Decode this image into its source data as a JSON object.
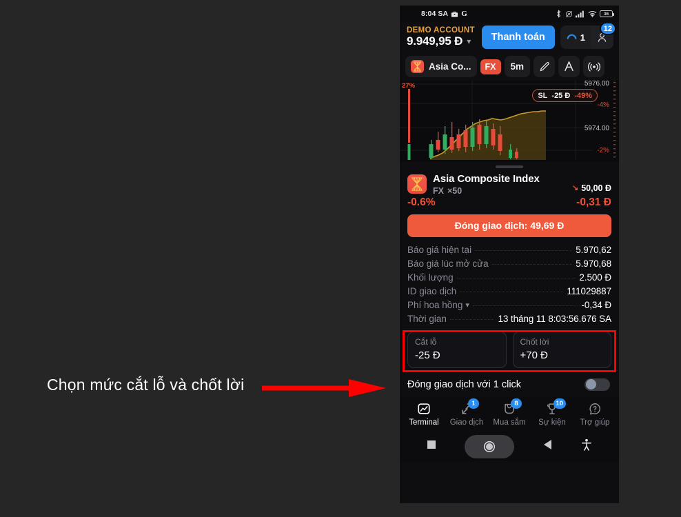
{
  "annotation": {
    "text": "Chọn mức cắt lỗ và chốt lời",
    "arrow_color": "#ff0000",
    "highlight_color": "#ff0000"
  },
  "statusbar": {
    "time": "8:04 SA",
    "icons_left": [
      "briefcase-icon",
      "google-icon"
    ],
    "google_glyph": "G",
    "icons_right": [
      "bluetooth-icon",
      "mute-icon",
      "signal-icon",
      "wifi-icon"
    ],
    "battery_level": "36"
  },
  "header": {
    "account_type": "DEMO ACCOUNT",
    "balance": "9.949,95 Đ",
    "pay_button": "Thanh toán",
    "message_count": "1",
    "profile_badge": "12"
  },
  "chart_toolbar": {
    "symbol": "Asia Co...",
    "market_tag": "FX",
    "timeframe": "5m",
    "icons": [
      "pencil-icon",
      "indicators-icon",
      "broadcast-icon"
    ]
  },
  "chart": {
    "top_left_pct": "27%",
    "price_top": "5976.00",
    "price_mid": "5974.00",
    "pct_labels": [
      "-4%",
      "-2%"
    ],
    "sl_tag": {
      "label": "SL",
      "value": "-25 Đ",
      "pct": "-49%"
    }
  },
  "position": {
    "title": "Asia Composite Index",
    "market": "FX",
    "leverage": "×50",
    "volume": "50,00 Đ",
    "change_pct": "-0.6%",
    "change_value": "-0,31 Đ",
    "close_button": "Đóng giao dịch: 49,69 Đ",
    "accent_color": "#f05a3c",
    "negative_color": "#ef5137"
  },
  "details": {
    "rows": [
      {
        "label": "Báo giá hiện tại",
        "value": "5.970,62"
      },
      {
        "label": "Báo giá lúc mở cửa",
        "value": "5.970,68"
      },
      {
        "label": "Khối lượng",
        "value": "2.500 Đ"
      },
      {
        "label": "ID giao dịch",
        "value": "111029887"
      },
      {
        "label": "Phí hoa hồng",
        "value": "-0,34 Đ"
      },
      {
        "label": "Thời gian",
        "value": "13 tháng 11 8:03:56.676 SA"
      }
    ]
  },
  "risk": {
    "stop_loss_label": "Cắt lỗ",
    "stop_loss_value": "-25 Đ",
    "take_profit_label": "Chốt lời",
    "take_profit_value": "+70 Đ"
  },
  "one_click": {
    "label": "Đóng giao dịch với 1 click",
    "enabled": false
  },
  "tabs": [
    {
      "label": "Terminal",
      "icon": "terminal-icon",
      "badge": "",
      "active": true
    },
    {
      "label": "Giao dịch",
      "icon": "trade-icon",
      "badge": "1",
      "active": false
    },
    {
      "label": "Mua sắm",
      "icon": "shop-icon",
      "badge": "8",
      "active": false
    },
    {
      "label": "Sự kiện",
      "icon": "trophy-icon",
      "badge": "10",
      "active": false
    },
    {
      "label": "Trợ giúp",
      "icon": "help-icon",
      "badge": "",
      "active": false
    }
  ],
  "android_nav": {
    "buttons": [
      "recents-square-icon",
      "home-circle-icon",
      "back-triangle-icon",
      "accessibility-icon"
    ]
  }
}
